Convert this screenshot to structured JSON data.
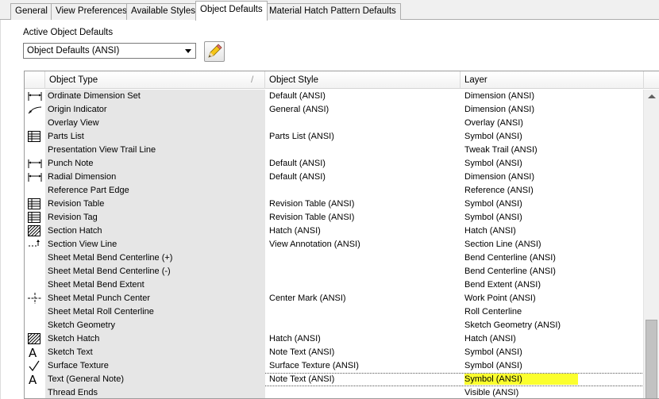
{
  "tabs": [
    {
      "label": "General"
    },
    {
      "label": "View Preferences"
    },
    {
      "label": "Available Styles"
    },
    {
      "label": "Object Defaults"
    },
    {
      "label": "Material Hatch Pattern Defaults"
    }
  ],
  "active_tab": "Object Defaults",
  "active_object_defaults": {
    "label": "Active Object Defaults",
    "selected": "Object Defaults (ANSI)"
  },
  "table": {
    "headers": {
      "object_type": "Object Type",
      "object_style": "Object Style",
      "layer": "Layer"
    },
    "rows": [
      {
        "icon": "dimension-icon",
        "type": "Ordinate Dimension Set",
        "style": "Default (ANSI)",
        "layer": "Dimension (ANSI)"
      },
      {
        "icon": "origin-indicator-icon",
        "type": "Origin Indicator",
        "style": "General (ANSI)",
        "layer": "Dimension (ANSI)"
      },
      {
        "icon": "",
        "type": "Overlay View",
        "style": "",
        "layer": "Overlay (ANSI)"
      },
      {
        "icon": "table-icon",
        "type": "Parts List",
        "style": "Parts List (ANSI)",
        "layer": "Symbol (ANSI)"
      },
      {
        "icon": "",
        "type": "Presentation View Trail Line",
        "style": "",
        "layer": "Tweak Trail (ANSI)"
      },
      {
        "icon": "dimension-icon",
        "type": "Punch Note",
        "style": "Default (ANSI)",
        "layer": "Symbol (ANSI)"
      },
      {
        "icon": "dimension-icon",
        "type": "Radial Dimension",
        "style": "Default (ANSI)",
        "layer": "Dimension (ANSI)"
      },
      {
        "icon": "",
        "type": "Reference Part Edge",
        "style": "",
        "layer": "Reference (ANSI)"
      },
      {
        "icon": "table-icon",
        "type": "Revision Table",
        "style": "Revision Table (ANSI)",
        "layer": "Symbol (ANSI)"
      },
      {
        "icon": "table-icon",
        "type": "Revision Tag",
        "style": "Revision Table (ANSI)",
        "layer": "Symbol (ANSI)"
      },
      {
        "icon": "hatch-icon",
        "type": "Section Hatch",
        "style": "Hatch (ANSI)",
        "layer": "Hatch (ANSI)"
      },
      {
        "icon": "section-line-icon",
        "type": "Section View Line",
        "style": "View Annotation (ANSI)",
        "layer": "Section Line (ANSI)"
      },
      {
        "icon": "",
        "type": "Sheet Metal Bend Centerline (+)",
        "style": "",
        "layer": "Bend Centerline (ANSI)"
      },
      {
        "icon": "",
        "type": "Sheet Metal Bend Centerline (-)",
        "style": "",
        "layer": "Bend Centerline (ANSI)"
      },
      {
        "icon": "",
        "type": "Sheet Metal Bend Extent",
        "style": "",
        "layer": "Bend Extent (ANSI)"
      },
      {
        "icon": "center-mark-icon",
        "type": "Sheet Metal Punch Center",
        "style": "Center Mark (ANSI)",
        "layer": "Work Point (ANSI)"
      },
      {
        "icon": "",
        "type": "Sheet Metal Roll Centerline",
        "style": "",
        "layer": "Roll Centerline"
      },
      {
        "icon": "",
        "type": "Sketch Geometry",
        "style": "",
        "layer": "Sketch Geometry (ANSI)"
      },
      {
        "icon": "hatch-icon",
        "type": "Sketch Hatch",
        "style": "Hatch (ANSI)",
        "layer": "Hatch (ANSI)"
      },
      {
        "icon": "text-icon",
        "type": "Sketch Text",
        "style": "Note Text (ANSI)",
        "layer": "Symbol (ANSI)"
      },
      {
        "icon": "surface-texture-icon",
        "type": "Surface Texture",
        "style": "Surface Texture (ANSI)",
        "layer": "Symbol (ANSI)"
      },
      {
        "icon": "text-icon",
        "type": "Text (General Note)",
        "style": "Note Text (ANSI)",
        "layer": "Symbol (ANSI)",
        "selected": true,
        "layer_highlight": "#fbff2e"
      },
      {
        "icon": "",
        "type": "Thread Ends",
        "style": "",
        "layer": "Visible (ANSI)"
      }
    ]
  }
}
